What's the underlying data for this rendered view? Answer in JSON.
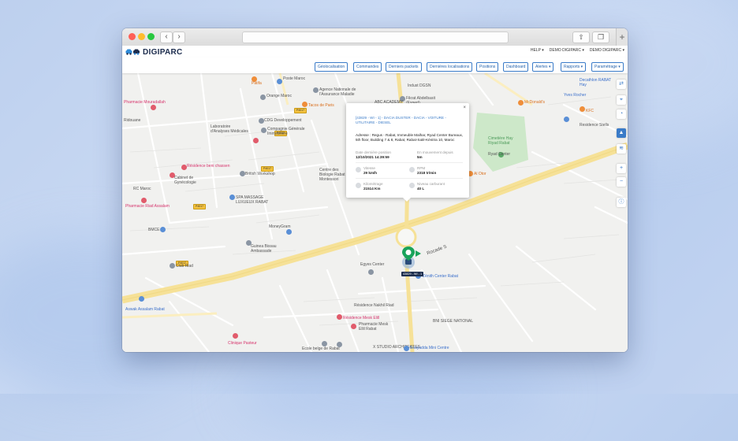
{
  "app": {
    "brand": "DIGIPARC",
    "top_menu": [
      "HELP",
      "DEMO DIGIPARC",
      "DEMO DIGIPARC"
    ]
  },
  "toolbar": {
    "buttons": [
      {
        "label": "Géolocalisation",
        "dropdown": false
      },
      {
        "label": "Commandes",
        "dropdown": false
      },
      {
        "label": "Derniers packets",
        "dropdown": false
      },
      {
        "label": "Dernières localisations",
        "dropdown": false
      },
      {
        "label": "Positions",
        "dropdown": false
      },
      {
        "label": "Dashboard",
        "dropdown": false
      },
      {
        "label": "Alertes",
        "dropdown": true
      },
      {
        "label": "Rapports",
        "dropdown": true
      },
      {
        "label": "Paramétrage",
        "dropdown": true
      }
    ]
  },
  "popup": {
    "title": "[43829 - WI - 1] - DACIA DUSTER - DACIA - VOITURE - UTILITAIRE - DIESEL",
    "address_label": "Adresse :",
    "address": "Regus - Rabat, Immeuble Malhar, Ryad Center Bureaux, 5th floor, Building 7 & 8, Rabat, Rabat-Salé-Kénitra 10, Maroc",
    "fields": [
      {
        "label": "Date dernière position",
        "value": "12/10/2021 14:39:59"
      },
      {
        "label": "En mouvement depuis",
        "value": "5m"
      },
      {
        "label": "Vitesse",
        "value": "29 km/h"
      },
      {
        "label": "RPM",
        "value": "2318 tr/min"
      },
      {
        "label": "Kilométrage",
        "value": "21514 Km"
      },
      {
        "label": "Niveau carburant",
        "value": "40 L"
      }
    ],
    "close": "×"
  },
  "vehicle_tag": "43829 - WI - 1",
  "map": {
    "labels": [
      {
        "text": "Poste Maroc",
        "cls": ""
      },
      {
        "text": "Agence Nationale de l'Assurance Maladie",
        "cls": ""
      },
      {
        "text": "Orange Maroc",
        "cls": ""
      },
      {
        "text": "Tacos de Paris",
        "cls": "orange"
      },
      {
        "text": "Pharmacie Mouradallah",
        "cls": "red"
      },
      {
        "text": "CDG Developpement",
        "cls": ""
      },
      {
        "text": "Compagnie Générale Immobilière",
        "cls": ""
      },
      {
        "text": "Laboratoire d'Analyses Médicales",
        "cls": ""
      },
      {
        "text": "Résidence beni chassen",
        "cls": "red"
      },
      {
        "text": "British Workshop",
        "cls": ""
      },
      {
        "text": "Cabinet de Gynécologie",
        "cls": ""
      },
      {
        "text": "Pharmacie Riad Assalam",
        "cls": "red"
      },
      {
        "text": "SPA MASSAGE LUXUEUX RABAT",
        "cls": ""
      },
      {
        "text": "BMCE",
        "cls": ""
      },
      {
        "text": "MoneyGram",
        "cls": ""
      },
      {
        "text": "Guinea Bissau Ambassade",
        "cls": ""
      },
      {
        "text": "Club Riad",
        "cls": ""
      },
      {
        "text": "Aswak Assalam Rabat",
        "cls": "blue"
      },
      {
        "text": "Résidence Nakhil Riad",
        "cls": ""
      },
      {
        "text": "Résidence Mesk Elill",
        "cls": "red"
      },
      {
        "text": "Pharmacie Mesk Ellil Rabat",
        "cls": ""
      },
      {
        "text": "Ecole belge de Rabat",
        "cls": ""
      },
      {
        "text": "X STUDIO ARCHITECTES",
        "cls": ""
      },
      {
        "text": "Bouyadda Mini Centre",
        "cls": "blue"
      },
      {
        "text": "Clinique Pasteur",
        "cls": "red"
      },
      {
        "text": "Zénith Center Rabat",
        "cls": "blue"
      },
      {
        "text": "BNI SIEGE NATIONAL",
        "cls": ""
      },
      {
        "text": "Egyes Center",
        "cls": ""
      },
      {
        "text": "Cimetière Hay Riyad Rabat",
        "cls": "green"
      },
      {
        "text": "Yves Rocher",
        "cls": "blue"
      },
      {
        "text": "McDonald's",
        "cls": "orange"
      },
      {
        "text": "KFC",
        "cls": "orange"
      },
      {
        "text": "Residence Stells",
        "cls": ""
      },
      {
        "text": "Rocade S",
        "cls": ""
      },
      {
        "text": "Fikrat Abdelbasit (Expert)",
        "cls": ""
      },
      {
        "text": "ABC ACADEMY",
        "cls": ""
      },
      {
        "text": "Indust DGSN",
        "cls": ""
      },
      {
        "text": "Pâtifa",
        "cls": "orange"
      },
      {
        "text": "Ridouane",
        "cls": ""
      },
      {
        "text": "RC Maroc",
        "cls": ""
      },
      {
        "text": "Centre des Biologie Rabat M Montessori",
        "cls": ""
      },
      {
        "text": "Decathlon RABAT Hay",
        "cls": "blue"
      },
      {
        "text": "Ryad Center",
        "cls": ""
      },
      {
        "text": "Al Otor",
        "cls": "orange"
      }
    ],
    "shields": [
      "P4017",
      "P4017",
      "P4017",
      "P4017",
      "P4017"
    ]
  },
  "map_controls": [
    "arrows-icon",
    "pin-icon",
    "satellite-icon",
    "traffic-icon",
    "layers-icon",
    "zoom-in-icon",
    "zoom-out-icon",
    "info-icon"
  ]
}
